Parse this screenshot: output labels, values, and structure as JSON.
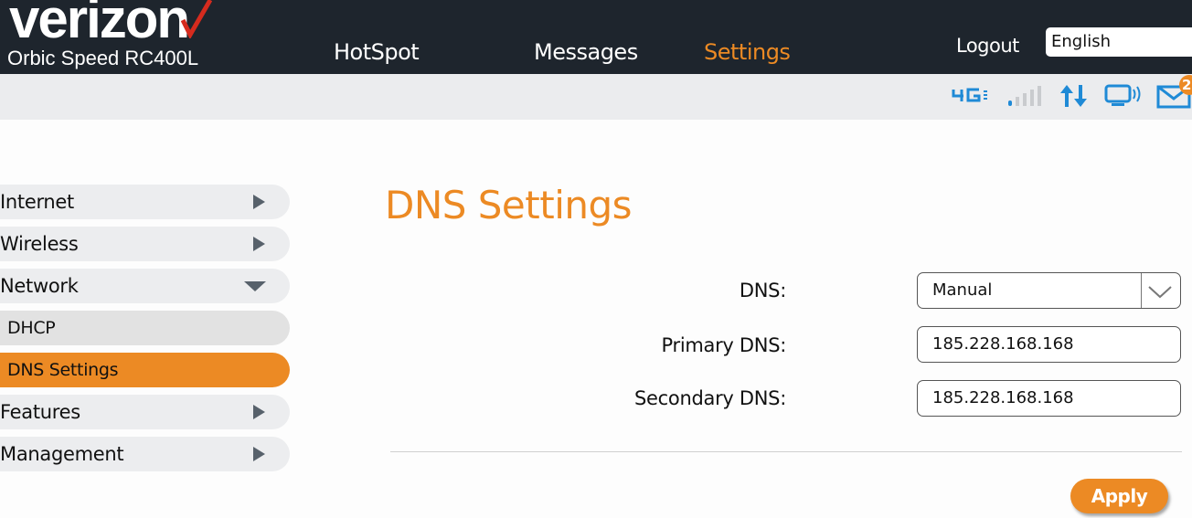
{
  "header": {
    "brand": "verizon",
    "model": "Orbic Speed RC400L",
    "nav": [
      {
        "label": "HotSpot",
        "active": false
      },
      {
        "label": "Messages",
        "active": false
      },
      {
        "label": "Settings",
        "active": true
      }
    ],
    "logout_label": "Logout",
    "language": "English"
  },
  "status": {
    "network_type": "4G LTE",
    "signal_bars": "1 of 5",
    "data_transfer_icon": "up-down-arrows",
    "connected_devices_icon": "monitor-wireless",
    "messages_unread": "2"
  },
  "sidebar": {
    "items": [
      {
        "label": "Internet",
        "type": "section",
        "expanded": false
      },
      {
        "label": "Wireless",
        "type": "section",
        "expanded": false
      },
      {
        "label": "Network",
        "type": "section",
        "expanded": true
      },
      {
        "label": "DHCP",
        "type": "sub",
        "active": false
      },
      {
        "label": "DNS Settings",
        "type": "sub",
        "active": true
      },
      {
        "label": "Features",
        "type": "section",
        "expanded": false
      },
      {
        "label": "Management",
        "type": "section",
        "expanded": false
      }
    ]
  },
  "main": {
    "title": "DNS Settings",
    "fields": [
      {
        "label": "DNS:",
        "value": "Manual",
        "type": "select"
      },
      {
        "label": "Primary DNS:",
        "value": "185.228.168.168",
        "type": "text"
      },
      {
        "label": "Secondary DNS:",
        "value": "185.228.168.168",
        "type": "text"
      }
    ],
    "apply_label": "Apply"
  },
  "colors": {
    "accent": "#ec8a24",
    "header_bg": "#1e252d",
    "status_icon_blue": "#1f8ad6",
    "verizon_check_red": "#d52b1e"
  }
}
